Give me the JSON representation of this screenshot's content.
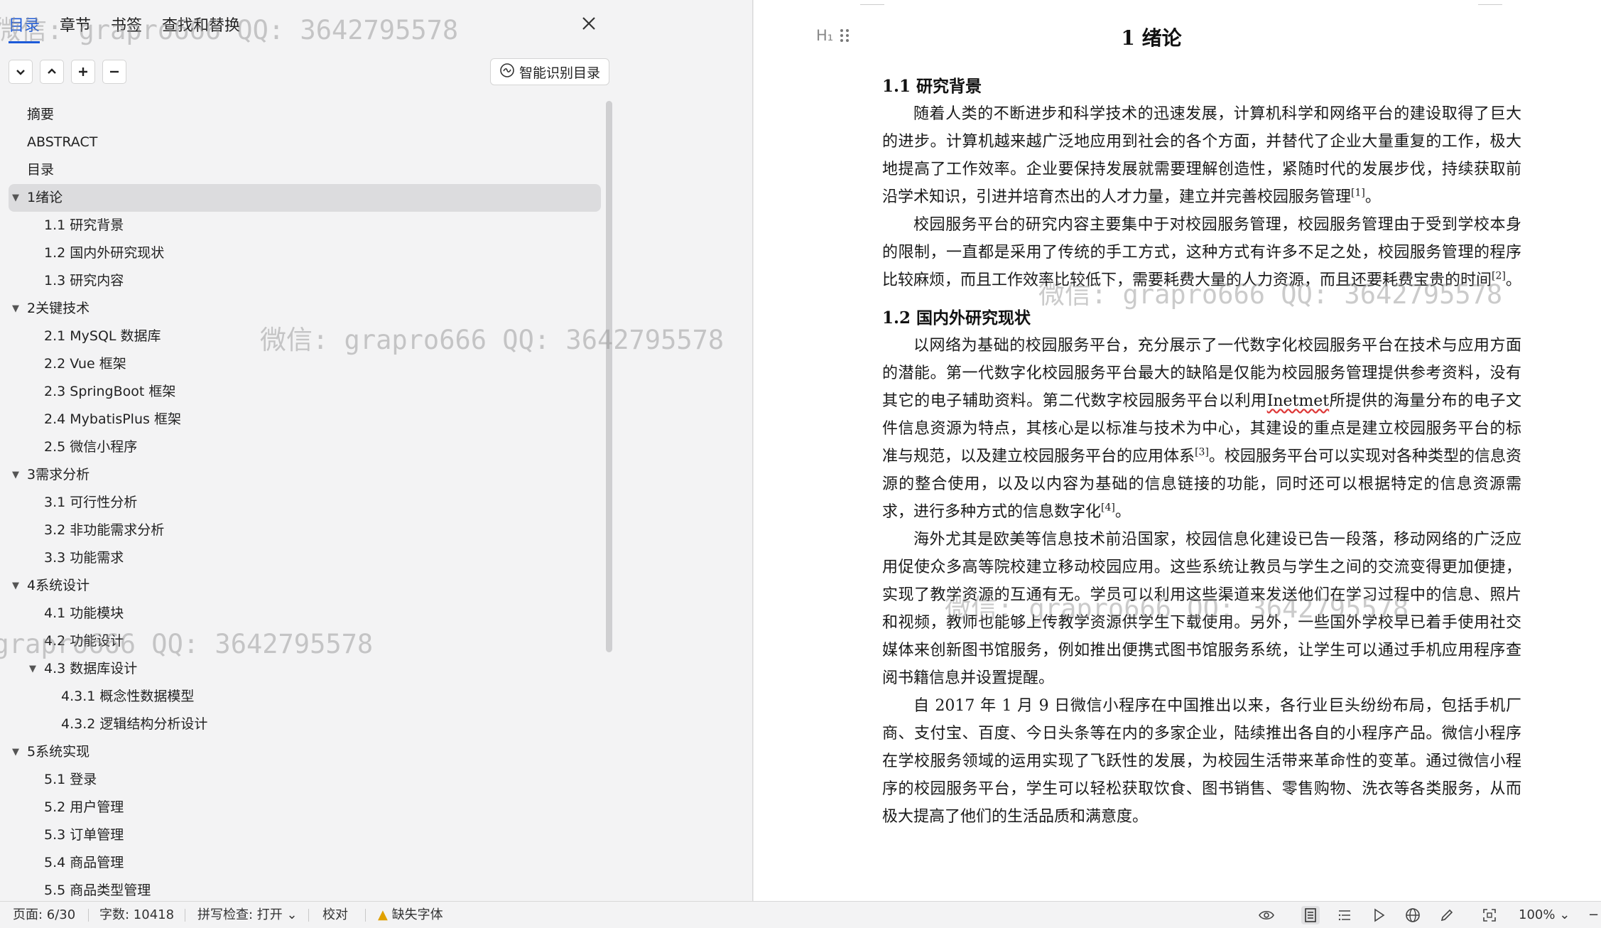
{
  "nav": {
    "tabs": [
      {
        "label": "目录",
        "active": true
      },
      {
        "label": "章节",
        "active": false
      },
      {
        "label": "书签",
        "active": false
      },
      {
        "label": "查找和替换",
        "active": false
      }
    ],
    "close_icon": "close-icon",
    "toolbar_icons": [
      "chevron-down-icon",
      "chevron-up-icon",
      "plus-icon",
      "minus-icon"
    ],
    "smart_toc_label": "智能识别目录",
    "toc": [
      {
        "label": "摘要",
        "level": 0,
        "expandable": false
      },
      {
        "label": "ABSTRACT",
        "level": 0,
        "expandable": false
      },
      {
        "label": "目录",
        "level": 0,
        "expandable": false
      },
      {
        "label": "1绪论",
        "level": 0,
        "expandable": true,
        "selected": true
      },
      {
        "label": "1.1  研究背景",
        "level": 1,
        "expandable": false
      },
      {
        "label": "1.2  国内外研究现状",
        "level": 1,
        "expandable": false
      },
      {
        "label": "1.3  研究内容",
        "level": 1,
        "expandable": false
      },
      {
        "label": "2关键技术",
        "level": 0,
        "expandable": true
      },
      {
        "label": "2.1  MySQL 数据库",
        "level": 1,
        "expandable": false
      },
      {
        "label": "2.2  Vue 框架",
        "level": 1,
        "expandable": false
      },
      {
        "label": "2.3  SpringBoot 框架",
        "level": 1,
        "expandable": false
      },
      {
        "label": "2.4  MybatisPlus 框架",
        "level": 1,
        "expandable": false
      },
      {
        "label": "2.5  微信小程序",
        "level": 1,
        "expandable": false
      },
      {
        "label": "3需求分析",
        "level": 0,
        "expandable": true
      },
      {
        "label": "3.1  可行性分析",
        "level": 1,
        "expandable": false
      },
      {
        "label": "3.2  非功能需求分析",
        "level": 1,
        "expandable": false
      },
      {
        "label": "3.3  功能需求",
        "level": 1,
        "expandable": false
      },
      {
        "label": "4系统设计",
        "level": 0,
        "expandable": true
      },
      {
        "label": "4.1  功能模块",
        "level": 1,
        "expandable": false
      },
      {
        "label": "4.2  功能设计",
        "level": 1,
        "expandable": false
      },
      {
        "label": "4.3  数据库设计",
        "level": 1,
        "expandable": true
      },
      {
        "label": "4.3.1  概念性数据模型",
        "level": 2,
        "expandable": false
      },
      {
        "label": "4.3.2  逻辑结构分析设计",
        "level": 2,
        "expandable": false
      },
      {
        "label": "5系统实现",
        "level": 0,
        "expandable": true
      },
      {
        "label": "5.1  登录",
        "level": 1,
        "expandable": false
      },
      {
        "label": "5.2  用户管理",
        "level": 1,
        "expandable": false
      },
      {
        "label": "5.3  订单管理",
        "level": 1,
        "expandable": false
      },
      {
        "label": "5.4  商品管理",
        "level": 1,
        "expandable": false
      },
      {
        "label": "5.5  商品类型管理",
        "level": 1,
        "expandable": false
      }
    ]
  },
  "document": {
    "heading_icon_label": "H₁",
    "chapter_title": "1    绪论",
    "sec1_title": "1.1  研究背景",
    "p1": "随着人类的不断进步和科学技术的迅速发展，计算机科学和网络平台的建设取得了巨大的进步。计算机越来越广泛地应用到社会的各个方面，并替代了企业大量重复的工作，极大地提高了工作效率。企业要保持发展就需要理解创造性，紧随时代的发展步伐，持续获取前沿学术知识，引进并培育杰出的人才力量，建立并完善校园服务管理",
    "p1_cite": "[1]",
    "p1_end": "。",
    "p2": "校园服务平台的研究内容主要集中于对校园服务管理，校园服务管理由于受到学校本身的限制，一直都是采用了传统的手工方式，这种方式有许多不足之处，校园服务管理的程序比较麻烦，而且工作效率比较低下，需要耗费大量的人力资源，而且还要耗费宝贵的时间",
    "p2_cite": "[2]",
    "p2_end": "。",
    "sec2_title": "1.2  国内外研究现状",
    "p3_a": "以网络为基础的校园服务平台，充分展示了一代数字化校园服务平台在技术与应用方面的潜能。第一代数字化校园服务平台最大的缺陷是仅能为校园服务管理提供参考资料，没有其它的电子辅助资料。第二代数字校园服务平台以利用",
    "p3_word": "Inetmet",
    "p3_b": "所提供的海量分布的电子文件信息资源为特点，其核心是以标准与技术为中心，其建设的重点是建立校园服务平台的标准与规范，以及建立校园服务平台的应用体系",
    "p3_cite1": "[3]",
    "p3_c": "。校园服务平台可以实现对各种类型的信息资源的整合使用，以及以内容为基础的信息链接的功能，同时还可以根据特定的信息资源需求，进行多种方式的信息数字化",
    "p3_cite2": "[4]",
    "p3_end": "。",
    "p4": "海外尤其是欧美等信息技术前沿国家，校园信息化建设已告一段落，移动网络的广泛应用促使众多高等院校建立移动校园应用。这些系统让教员与学生之间的交流变得更加便捷，实现了教学资源的互通有无。学员可以利用这些渠道来发送他们在学习过程中的信息、照片和视频，教师也能够上传教学资源供学生下载使用。另外，一些国外学校早已着手使用社交媒体来创新图书馆服务，例如推出便携式图书馆服务系统，让学生可以通过手机应用程序查阅书籍信息并设置提醒。",
    "p5": "自 2017 年 1 月 9 日微信小程序在中国推出以来，各行业巨头纷纷布局，包括手机厂商、支付宝、百度、今日头条等在内的多家企业，陆续推出各自的小程序产品。微信小程序在学校服务领域的运用实现了飞跃性的发展，为校园生活带来革命性的变革。通过微信小程序的校园服务平台，学生可以轻松获取饮食、图书销售、零售购物、洗衣等各类服务，从而极大提高了他们的生活品质和满意度。"
  },
  "status": {
    "page": "页面: 6/30",
    "words": "字数: 10418",
    "spell": "拼写检查: 打开",
    "proof": "校对",
    "missing_font": "缺失字体",
    "zoom": "100%",
    "icons": [
      "eye-icon",
      "page-view-icon",
      "outline-view-icon",
      "play-icon",
      "web-view-icon",
      "pen-icon",
      "fit-page-icon"
    ]
  },
  "watermark": "微信: grapro666 QQ: 3642795578"
}
